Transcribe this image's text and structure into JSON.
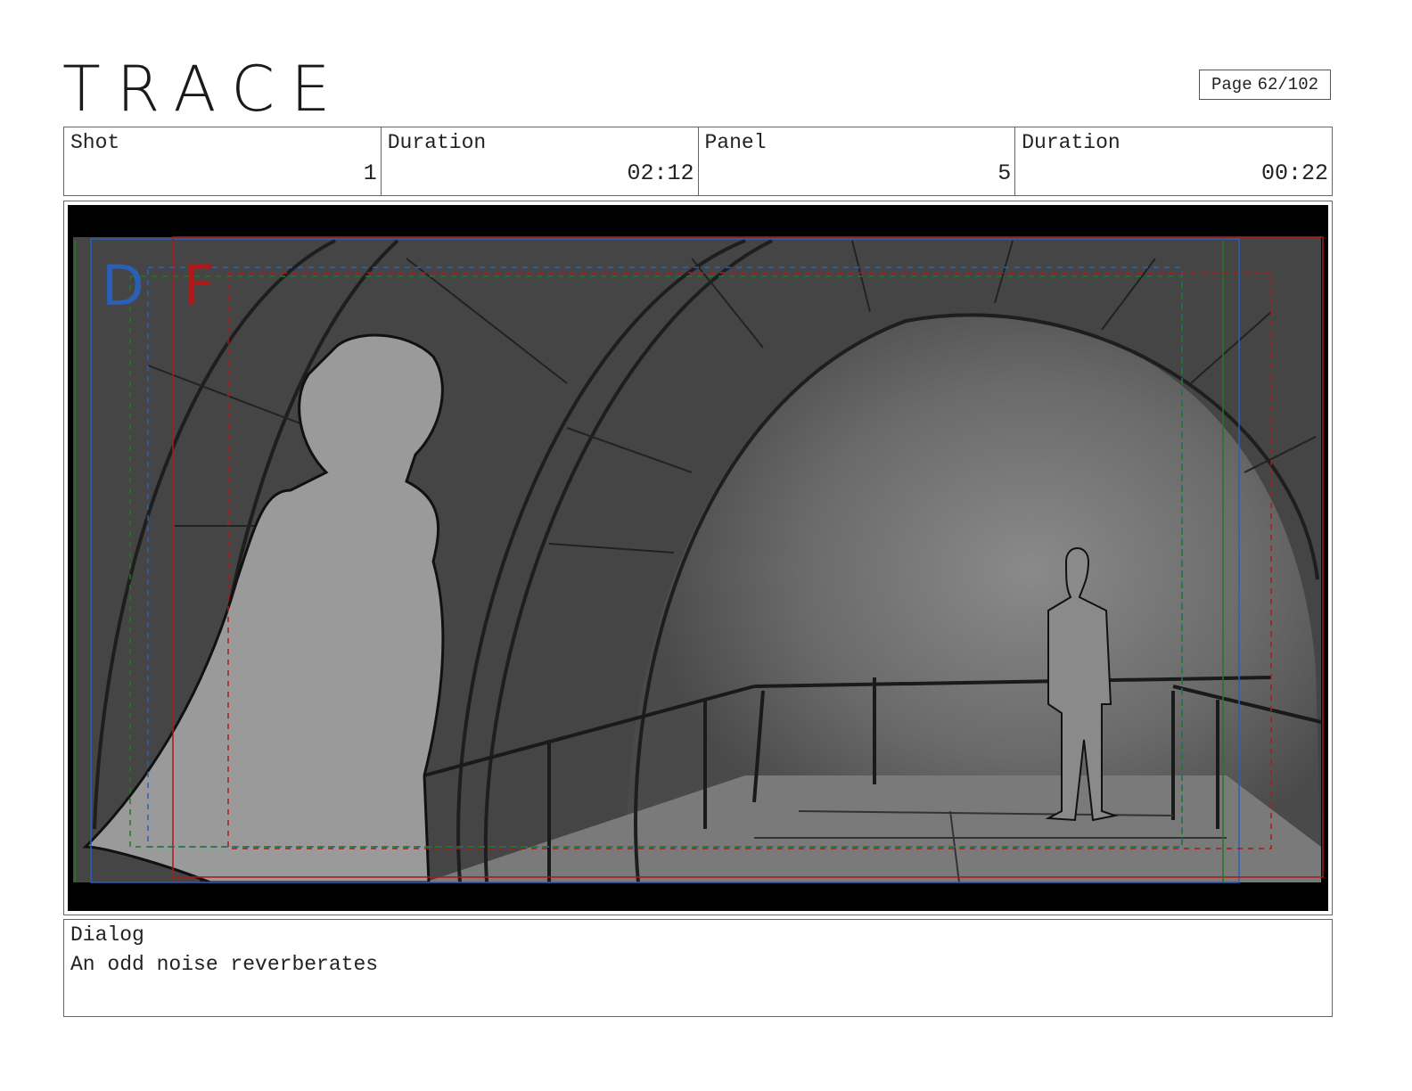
{
  "header": {
    "title": "TRACE",
    "page_label": "Page",
    "page_value": "62/102"
  },
  "info": {
    "shot_label": "Shot",
    "shot_value": "1",
    "shot_duration_label": "Duration",
    "shot_duration_value": "02:12",
    "panel_label": "Panel",
    "panel_value": "5",
    "panel_duration_label": "Duration",
    "panel_duration_value": "00:22"
  },
  "frame": {
    "marker_d": "D",
    "marker_f": "F",
    "marker_d_color": "#2a5fb8",
    "marker_f_color": "#b01818"
  },
  "dialog": {
    "label": "Dialog",
    "text": "An odd noise reverberates"
  }
}
